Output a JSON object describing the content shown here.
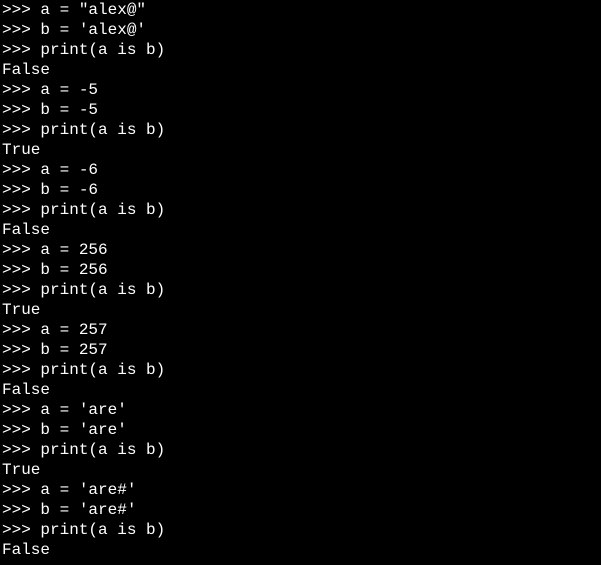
{
  "terminal": {
    "prompt": ">>> ",
    "lines": [
      {
        "type": "input",
        "text": "a = \"alex@\""
      },
      {
        "type": "input",
        "text": "b = 'alex@'"
      },
      {
        "type": "input",
        "text": "print(a is b)"
      },
      {
        "type": "output",
        "text": "False"
      },
      {
        "type": "input",
        "text": "a = -5"
      },
      {
        "type": "input",
        "text": "b = -5"
      },
      {
        "type": "input",
        "text": "print(a is b)"
      },
      {
        "type": "output",
        "text": "True"
      },
      {
        "type": "input",
        "text": "a = -6"
      },
      {
        "type": "input",
        "text": "b = -6"
      },
      {
        "type": "input",
        "text": "print(a is b)"
      },
      {
        "type": "output",
        "text": "False"
      },
      {
        "type": "input",
        "text": "a = 256"
      },
      {
        "type": "input",
        "text": "b = 256"
      },
      {
        "type": "input",
        "text": "print(a is b)"
      },
      {
        "type": "output",
        "text": "True"
      },
      {
        "type": "input",
        "text": "a = 257"
      },
      {
        "type": "input",
        "text": "b = 257"
      },
      {
        "type": "input",
        "text": "print(a is b)"
      },
      {
        "type": "output",
        "text": "False"
      },
      {
        "type": "input",
        "text": "a = 'are'"
      },
      {
        "type": "input",
        "text": "b = 'are'"
      },
      {
        "type": "input",
        "text": "print(a is b)"
      },
      {
        "type": "output",
        "text": "True"
      },
      {
        "type": "input",
        "text": "a = 'are#'"
      },
      {
        "type": "input",
        "text": "b = 'are#'"
      },
      {
        "type": "input",
        "text": "print(a is b)"
      },
      {
        "type": "output",
        "text": "False"
      }
    ]
  }
}
